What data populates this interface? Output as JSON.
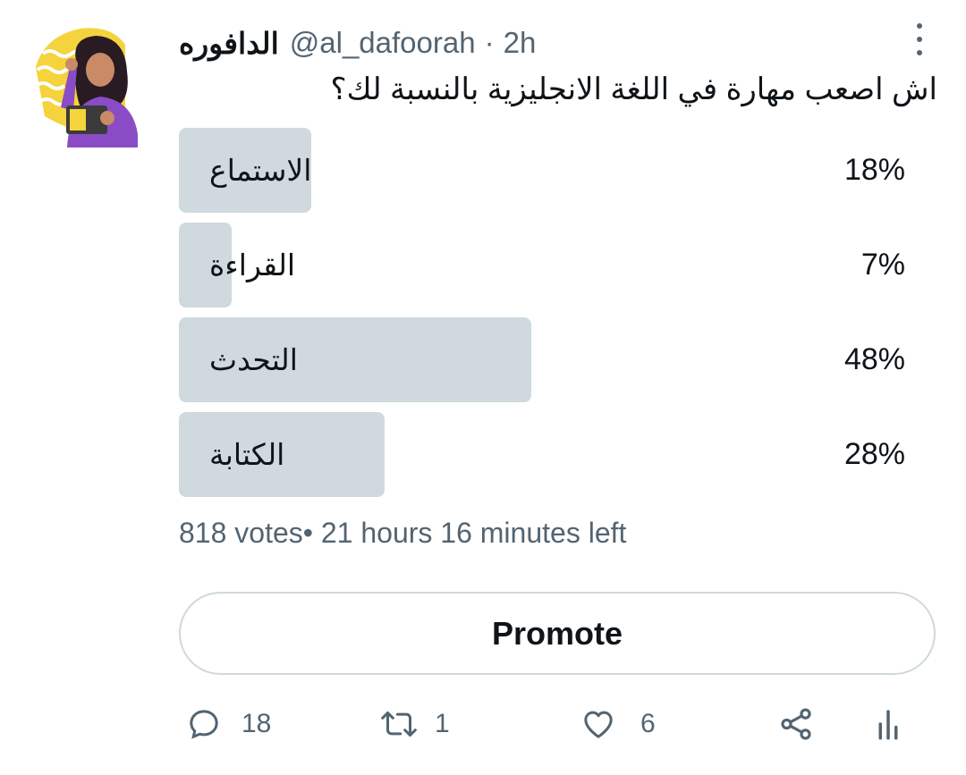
{
  "tweet": {
    "display_name": "الدافوره",
    "handle": "@al_dafoorah",
    "separator": "·",
    "time": "2h",
    "text": "اش اصعب مهارة في اللغة الانجليزية بالنسبة لك؟"
  },
  "poll": {
    "options": [
      {
        "label": "الاستماع",
        "percent_text": "18%",
        "percent": 18
      },
      {
        "label": "القراءة",
        "percent_text": "7%",
        "percent": 7
      },
      {
        "label": "التحدث",
        "percent_text": "48%",
        "percent": 48
      },
      {
        "label": "الكتابة",
        "percent_text": "28%",
        "percent": 28
      }
    ],
    "meta": "818 votes• 21 hours 16 minutes left"
  },
  "promote_label": "Promote",
  "actions": {
    "reply": {
      "icon": "reply-icon",
      "count": "18"
    },
    "retweet": {
      "icon": "retweet-icon",
      "count": "1"
    },
    "like": {
      "icon": "like-icon",
      "count": "6"
    },
    "share": {
      "icon": "share-icon"
    },
    "analytics": {
      "icon": "analytics-icon"
    }
  },
  "colors": {
    "bar": "#cfd9de",
    "secondary_text": "#536471",
    "primary_text": "#0f1419",
    "avatar_shirt": "#8a4cc5",
    "avatar_bg": "#f2d33a"
  }
}
